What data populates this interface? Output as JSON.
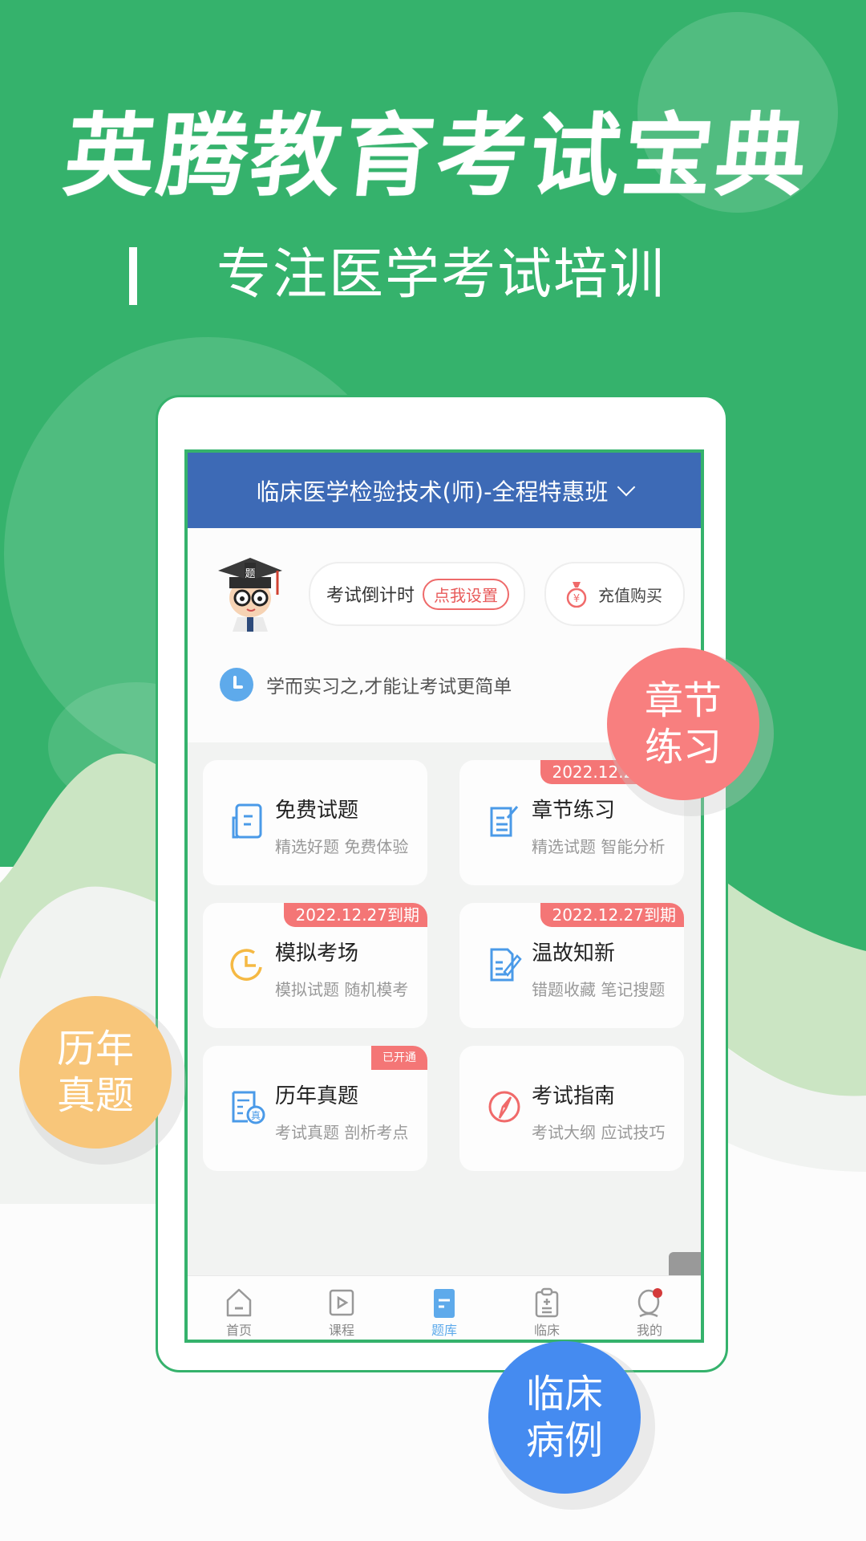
{
  "banner": {
    "title": "英腾教育考试宝典",
    "subtitle": "专注医学考试培训"
  },
  "app": {
    "header_title": "临床医学检验技术(师)-全程特惠班",
    "countdown_label": "考试倒计时",
    "countdown_button": "点我设置",
    "recharge_label": "充值购买",
    "motto": "学而实习之,才能让考试更简单",
    "cards": [
      {
        "title": "免费试题",
        "subtitle": "精选好题 免费体验",
        "icon": "document-icon",
        "badge": null
      },
      {
        "title": "章节练习",
        "subtitle": "精选试题 智能分析",
        "icon": "edit-list-icon",
        "badge": "2022.12.27到期"
      },
      {
        "title": "模拟考场",
        "subtitle": "模拟试题 随机模考",
        "icon": "clock-icon",
        "badge": "2022.12.27到期"
      },
      {
        "title": "温故知新",
        "subtitle": "错题收藏 笔记搜题",
        "icon": "note-pen-icon",
        "badge": "2022.12.27到期"
      },
      {
        "title": "历年真题",
        "subtitle": "考试真题 剖析考点",
        "icon": "exam-paper-icon",
        "badge": "已开通"
      },
      {
        "title": "考试指南",
        "subtitle": "考试大纲 应试技巧",
        "icon": "compass-icon",
        "badge": null
      }
    ],
    "nav": [
      {
        "label": "首页",
        "icon": "home-icon",
        "active": false
      },
      {
        "label": "课程",
        "icon": "play-icon",
        "active": false
      },
      {
        "label": "题库",
        "icon": "question-bank-icon",
        "active": true
      },
      {
        "label": "临床",
        "icon": "clipboard-icon",
        "active": false
      },
      {
        "label": "我的",
        "icon": "profile-icon",
        "active": false
      }
    ]
  },
  "bubbles": {
    "chapter": "章节\n练习",
    "past_exams": "历年\n真题",
    "clinical": "临床\n病例"
  },
  "colors": {
    "brand_green": "#35b26c",
    "header_blue": "#3d6ab6",
    "badge_red": "#f47676",
    "active_blue": "#5eaaeb"
  }
}
